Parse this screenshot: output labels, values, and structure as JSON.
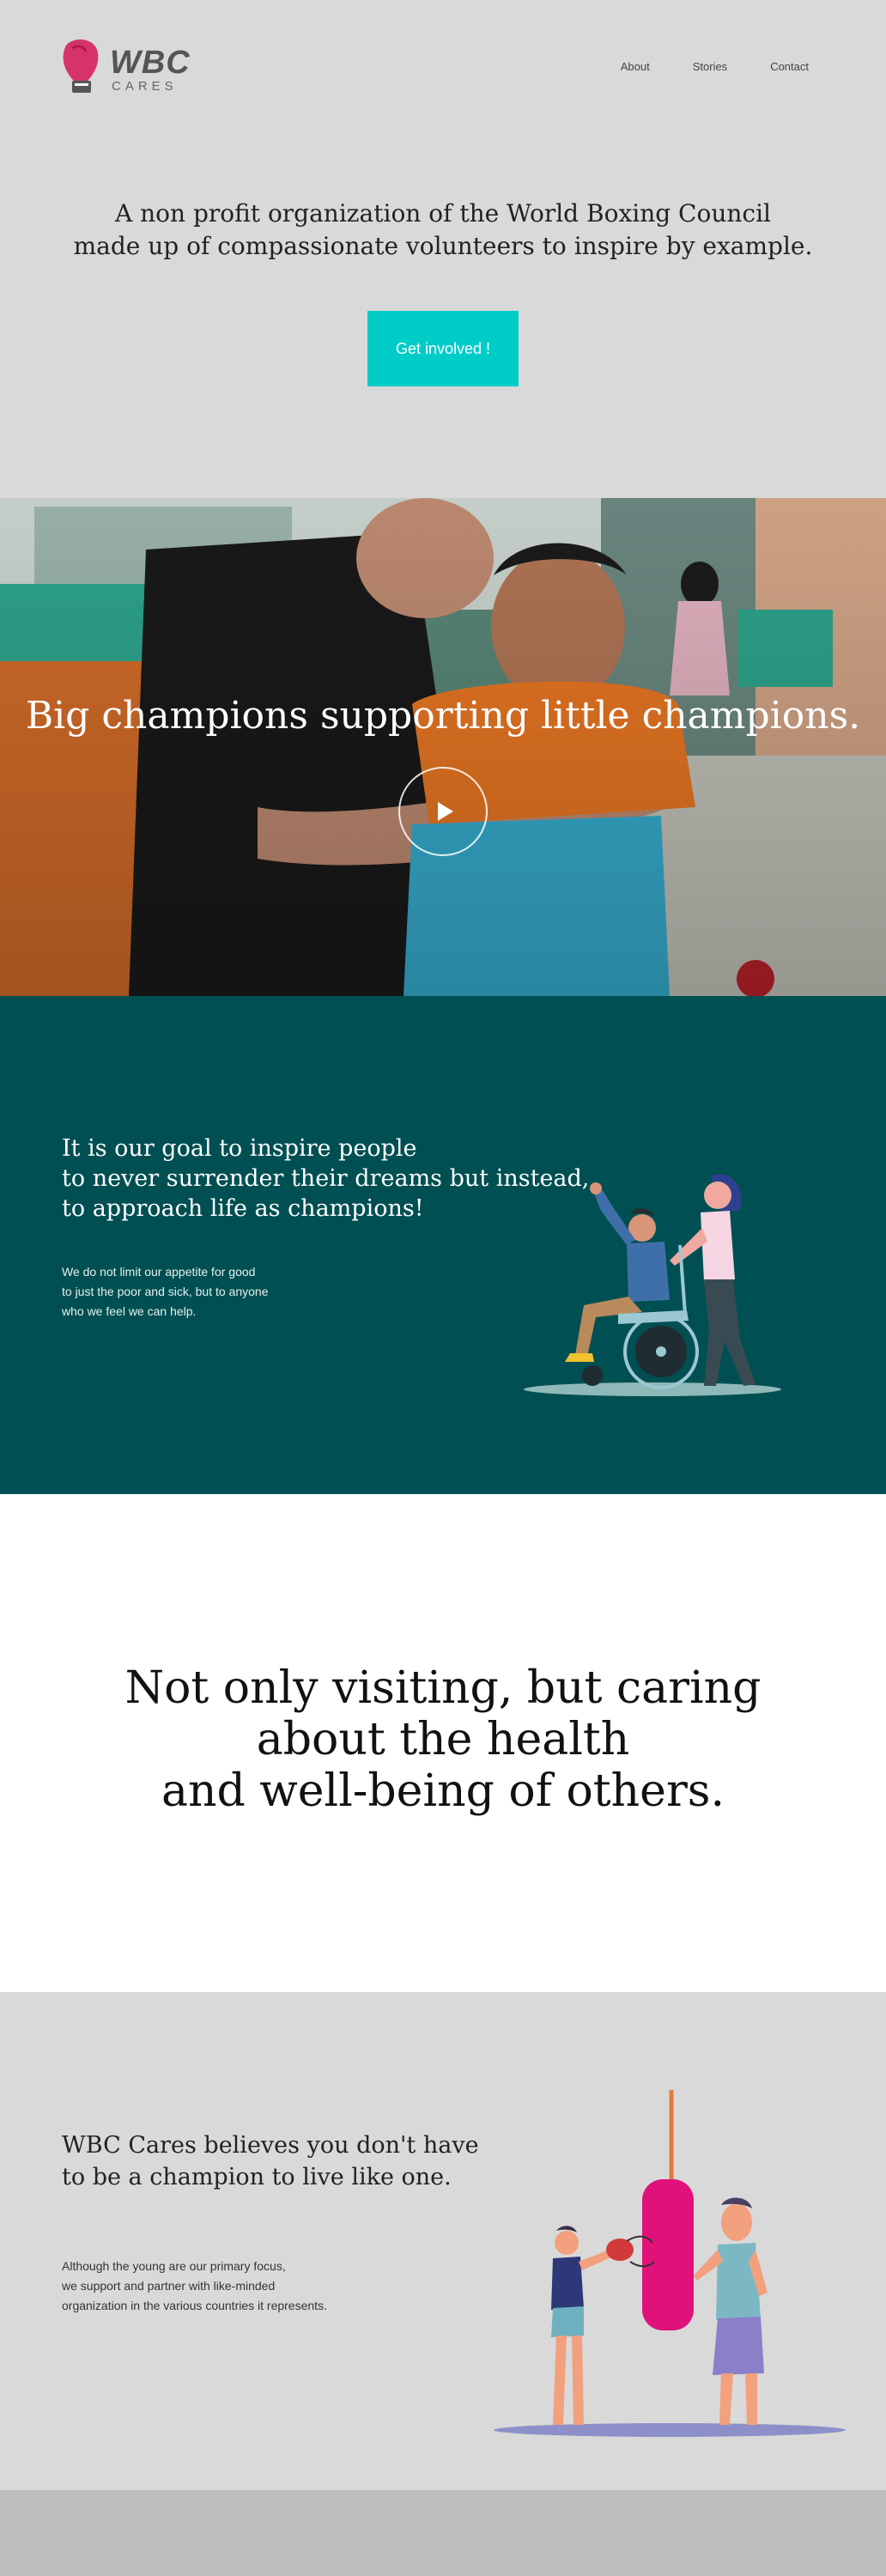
{
  "header": {
    "logo_text": "WBC",
    "logo_subtext": "CARES",
    "nav": [
      "About",
      "Stories",
      "Contact"
    ]
  },
  "intro": {
    "lines": [
      "A non profit organization of the World Boxing Council",
      "made up of compassionate volunteers to inspire by example."
    ],
    "cta_label": "Get involved !"
  },
  "video_band": {
    "headline": "Big champions supporting little champions.",
    "play_icon": "play-icon"
  },
  "goal": {
    "heading_lines": [
      "It is our goal to inspire people",
      "to never surrender their dreams but instead,",
      "to approach life as champions!"
    ],
    "body_lines": [
      "We do not limit our appetite for good",
      "to just the poor and sick, but to anyone",
      "who we feel we can help."
    ]
  },
  "caring": {
    "heading_lines": [
      "Not only visiting, but caring",
      "about the health",
      "and well-being of others."
    ]
  },
  "champion": {
    "heading_lines": [
      "WBC Cares believes you don't have",
      "to be a champion to live like one."
    ],
    "body_lines": [
      "Although the young are our primary focus,",
      "we support and partner with like-minded",
      "organization in the various countries it represents."
    ]
  },
  "colors": {
    "accent": "#00ccc8",
    "teal_section": "#004f52",
    "page_gray": "#d9d9d9",
    "logo_pink": "#d6336c"
  }
}
